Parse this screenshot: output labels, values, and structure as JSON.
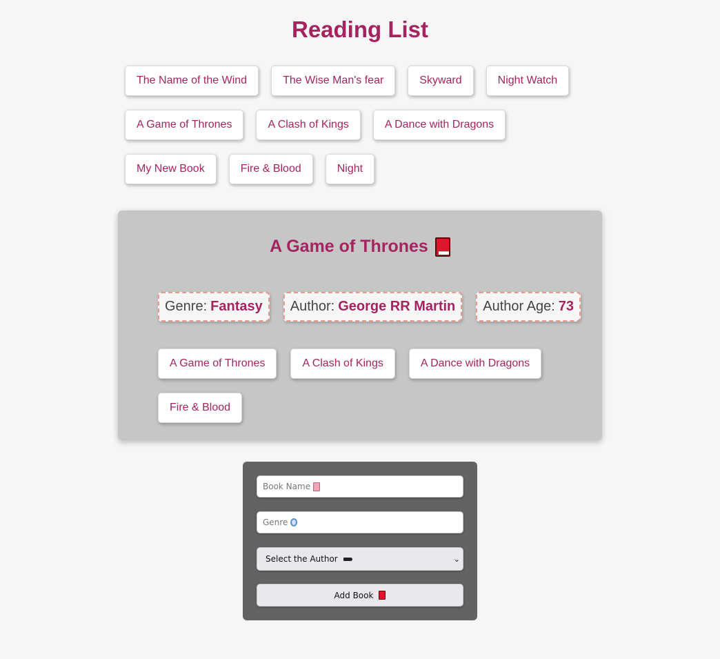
{
  "page_title": "Reading List",
  "books": [
    "The Name of the Wind",
    "The Wise Man's fear",
    "Skyward",
    "Night Watch",
    "A Game of Thrones",
    "A Clash of Kings",
    "A Dance with Dragons",
    "My New Book",
    "Fire & Blood",
    "Night"
  ],
  "details": {
    "title": "A Game of Thrones",
    "title_icon": "red-book-icon",
    "genre_label": "Genre:",
    "genre_value": "Fantasy",
    "author_label": "Author:",
    "author_value": "George RR Martin",
    "age_label": "Author Age:",
    "age_value": "73",
    "related_books": [
      "A Game of Thrones",
      "A Clash of Kings",
      "A Dance with Dragons",
      "Fire & Blood"
    ]
  },
  "form": {
    "book_name_placeholder": "Book Name",
    "book_name_icon": "book-icon",
    "genre_placeholder": "Genre",
    "genre_icon": "gem-icon",
    "author_select_label": "Select the Author",
    "author_select_icon": "pen-icon",
    "add_button_label": "Add Book",
    "add_button_icon": "red-book-icon"
  },
  "colors": {
    "accent": "#a3245f",
    "background": "#f6f6f6",
    "details_panel": "#c6c6c6",
    "form_panel": "#636363"
  }
}
